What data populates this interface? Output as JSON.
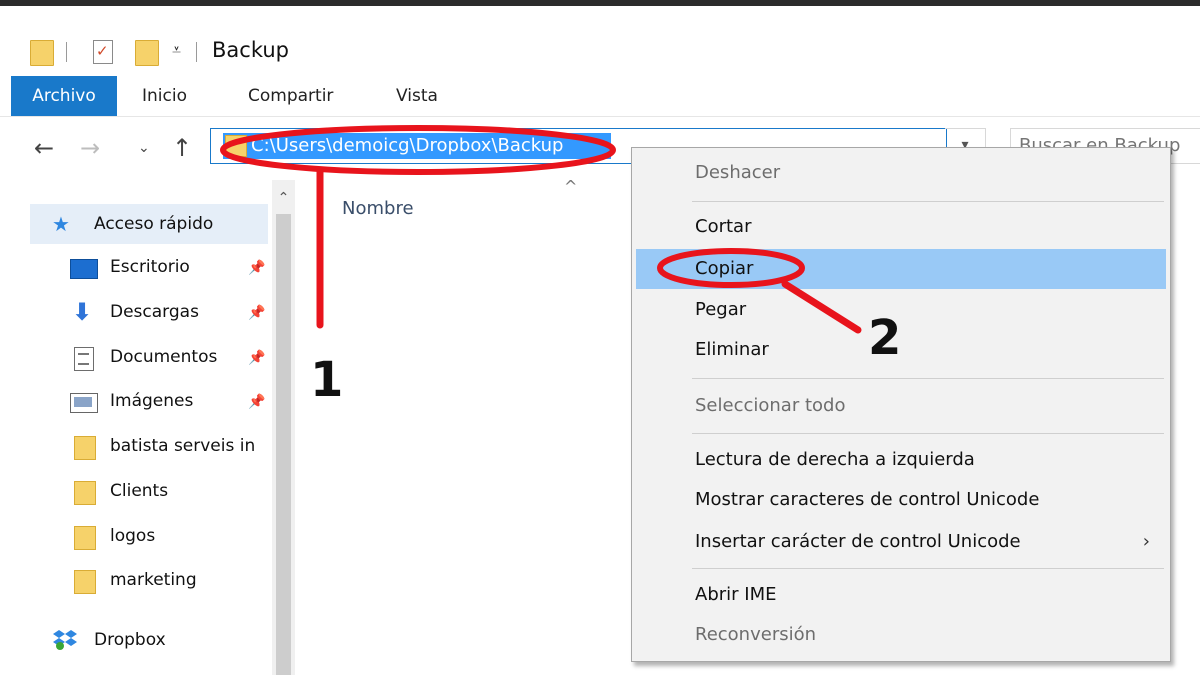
{
  "window": {
    "title": "Backup"
  },
  "ribbon": {
    "tabs": [
      {
        "label": "Archivo"
      },
      {
        "label": "Inicio"
      },
      {
        "label": "Compartir"
      },
      {
        "label": "Vista"
      }
    ]
  },
  "address_bar": {
    "path": "C:\\Users\\demoicg\\Dropbox\\Backup"
  },
  "search": {
    "placeholder": "Buscar en Backup"
  },
  "nav_pane": {
    "quick_access_label": "Acceso rápido",
    "items": [
      {
        "label": "Escritorio",
        "icon": "desktop-icon",
        "pinned": true
      },
      {
        "label": "Descargas",
        "icon": "download-icon",
        "pinned": true
      },
      {
        "label": "Documentos",
        "icon": "document-icon",
        "pinned": true
      },
      {
        "label": "Imágenes",
        "icon": "pictures-icon",
        "pinned": true
      },
      {
        "label": "batista serveis in",
        "icon": "folder-icon",
        "pinned": false
      },
      {
        "label": "Clients",
        "icon": "folder-icon",
        "pinned": false
      },
      {
        "label": "logos",
        "icon": "folder-icon",
        "pinned": false
      },
      {
        "label": "marketing",
        "icon": "folder-icon",
        "pinned": false
      }
    ],
    "dropbox_label": "Dropbox"
  },
  "content": {
    "column_name": "Nombre"
  },
  "context_menu": {
    "items": [
      {
        "label": "Deshacer",
        "enabled": false
      },
      {
        "label": "Cortar",
        "enabled": true
      },
      {
        "label": "Copiar",
        "enabled": true,
        "highlighted": true
      },
      {
        "label": "Pegar",
        "enabled": true
      },
      {
        "label": "Eliminar",
        "enabled": true
      },
      {
        "label": "Seleccionar todo",
        "enabled": false
      },
      {
        "label": "Lectura de derecha a izquierda",
        "enabled": true
      },
      {
        "label": "Mostrar caracteres de control Unicode",
        "enabled": true
      },
      {
        "label": "Insertar carácter de control Unicode",
        "enabled": true,
        "submenu": true
      },
      {
        "label": "Abrir IME",
        "enabled": true
      },
      {
        "label": "Reconversión",
        "enabled": false
      }
    ]
  },
  "annotations": {
    "step1": "1",
    "step2": "2",
    "color": "#e8141c"
  },
  "colors": {
    "accent": "#1979ca",
    "selection": "#3399ff",
    "menu_highlight": "#99c9f6",
    "folder": "#f6d26a"
  }
}
